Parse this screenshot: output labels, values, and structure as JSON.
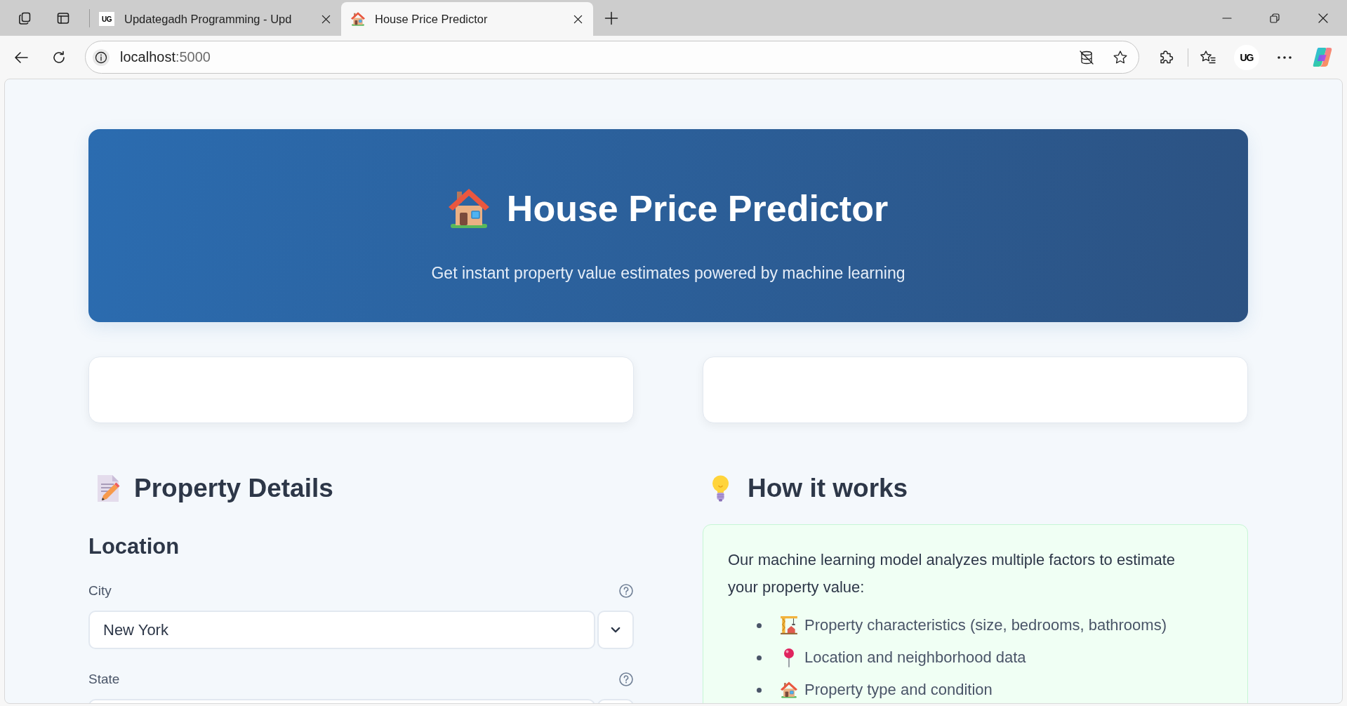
{
  "browser": {
    "tabs": [
      {
        "kind": "site",
        "favicon_text": "UG",
        "title": "Updategadh Programming - Upd",
        "selected": false
      },
      {
        "kind": "house",
        "title": "House Price Predictor",
        "selected": true
      }
    ],
    "url": {
      "host": "localhost",
      "port": ":5000"
    },
    "profile": "UG"
  },
  "header": {
    "title": "House Price Predictor",
    "subtitle": "Get instant property value estimates powered by machine learning"
  },
  "property_details": {
    "heading": "Property Details",
    "section": "Location",
    "fields": [
      {
        "kind": "select",
        "label": "City",
        "value": "New York"
      },
      {
        "kind": "select",
        "label": "State"
      }
    ]
  },
  "how_it_works": {
    "heading": "How it works",
    "intro": "Our machine learning model analyzes multiple factors to estimate your property value:",
    "factors": [
      {
        "kind": "construction",
        "text": "Property characteristics (size, bedrooms, bathrooms)"
      },
      {
        "kind": "pin",
        "text": "Location and neighborhood data"
      },
      {
        "kind": "house",
        "text": "Property type and condition"
      }
    ]
  }
}
